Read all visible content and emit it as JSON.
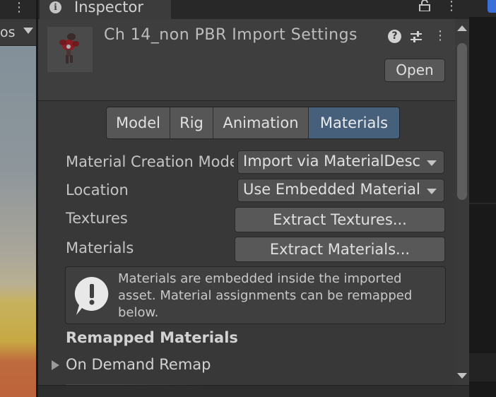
{
  "left_panel": {
    "toolbar_text": "os",
    "kebab_icon": "kebab-menu-icon",
    "dropdown_icon": "dropdown-arrow-icon"
  },
  "inspector": {
    "tab_title": "Inspector",
    "tab_icon": "info-icon",
    "lock_icon": "lock-icon",
    "kebab_icon": "kebab-menu-icon",
    "header": {
      "asset_title": "Ch 14_non PBR Import Settings",
      "help_icon": "help-icon",
      "presets_icon": "presets-sliders-icon",
      "open_label": "Open"
    },
    "tabs": [
      {
        "label": "Model",
        "active": false
      },
      {
        "label": "Rig",
        "active": false
      },
      {
        "label": "Animation",
        "active": false
      },
      {
        "label": "Materials",
        "active": true
      }
    ],
    "properties": {
      "material_creation_mode": {
        "label": "Material Creation Mode",
        "value": "Import via MaterialDescription"
      },
      "location": {
        "label": "Location",
        "value": "Use Embedded Materials"
      },
      "textures": {
        "label": "Textures",
        "button": "Extract Textures..."
      },
      "materials": {
        "label": "Materials",
        "button": "Extract Materials..."
      }
    },
    "help_box": {
      "icon": "warning-exclamation-icon",
      "text": "Materials are embedded inside the imported asset. Material assignments can be remapped below."
    },
    "remapped": {
      "header": "Remapped Materials",
      "on_demand_label": "On Demand Remap"
    }
  },
  "colors": {
    "active_tab": "#46607c",
    "tab_accent": "#3a79bb",
    "panel_bg": "#383838"
  }
}
